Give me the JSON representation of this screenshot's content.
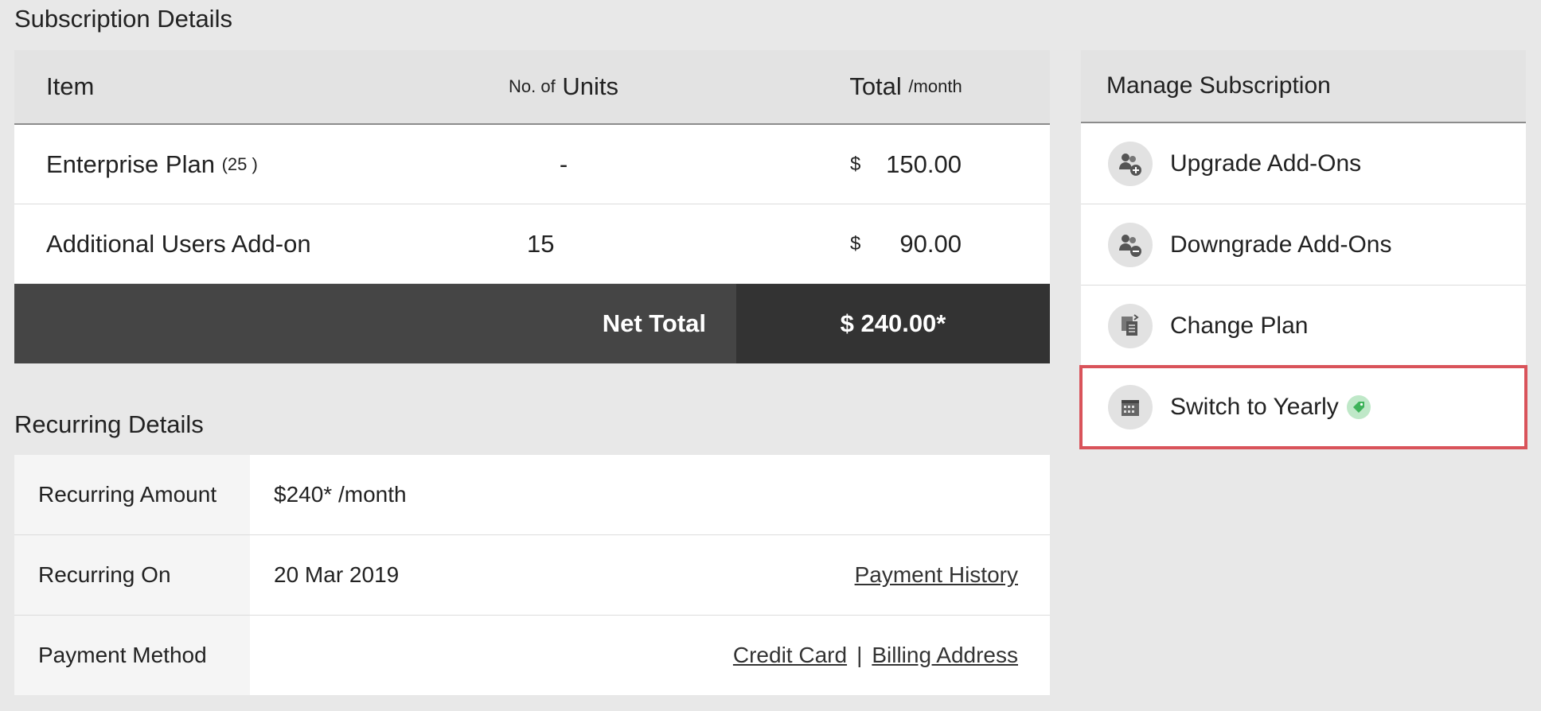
{
  "subscription": {
    "title": "Subscription Details",
    "headers": {
      "item": "Item",
      "units_prefix": "No. of",
      "units": "Units",
      "total": "Total",
      "total_suffix": "/month"
    },
    "rows": [
      {
        "name": "Enterprise Plan",
        "qualifier": "(25 )",
        "units": "-",
        "currency": "$",
        "amount": "150.00"
      },
      {
        "name": "Additional Users Add-on",
        "qualifier": "",
        "units": "15",
        "currency": "$",
        "amount": "90.00"
      }
    ],
    "net_total_label": "Net Total",
    "net_total_value": "$ 240.00*"
  },
  "manage": {
    "title": "Manage Subscription",
    "items": [
      {
        "label": "Upgrade Add-Ons",
        "icon": "users-plus-icon"
      },
      {
        "label": "Downgrade Add-Ons",
        "icon": "users-minus-icon"
      },
      {
        "label": "Change Plan",
        "icon": "document-swap-icon"
      },
      {
        "label": "Switch to Yearly",
        "icon": "calendar-icon",
        "highlighted": true,
        "badge_icon": "tag-icon"
      }
    ]
  },
  "recurring": {
    "title": "Recurring Details",
    "rows": [
      {
        "label": "Recurring Amount",
        "value": "$240* /month"
      },
      {
        "label": "Recurring On",
        "value": "20 Mar 2019",
        "link": "Payment History"
      },
      {
        "label": "Payment Method",
        "value": "",
        "links": [
          "Credit Card",
          "Billing Address"
        ],
        "separator": "|"
      }
    ]
  },
  "colors": {
    "highlight_border": "#d9535a",
    "footer_dark": "#454545",
    "footer_darker": "#333333",
    "tag_green": "#bfe8c8"
  }
}
